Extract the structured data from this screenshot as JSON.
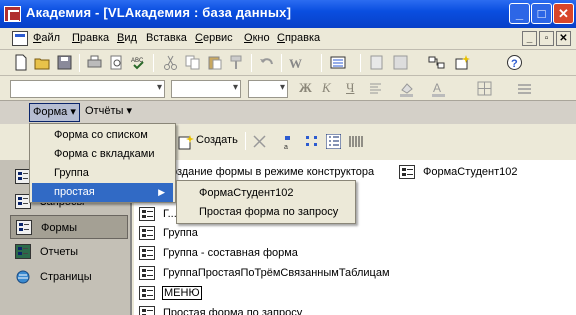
{
  "title": "Академия - [VLАкадемия : база данных]",
  "title_controls": [
    "_",
    "□",
    "✕"
  ],
  "menu": {
    "items": [
      {
        "u": "Ф",
        "rest": "айл"
      },
      {
        "u": "П",
        "rest": "равка"
      },
      {
        "u": "В",
        "rest": "ид"
      },
      {
        "u": "",
        "rest": "Вставка"
      },
      {
        "u": "С",
        "rest": "ервис"
      },
      {
        "u": "О",
        "rest": "кно"
      },
      {
        "u": "С",
        "rest": "правка"
      }
    ],
    "doc_controls": [
      "_",
      "▫",
      "✕"
    ]
  },
  "format_buttons": [
    "Ж",
    "К",
    "Ч"
  ],
  "object_bar": {
    "forma": "Форма ▾",
    "otchety": "Отчёты ▾"
  },
  "db_toolbar": {
    "create_label": "Создать"
  },
  "dropdown": {
    "items": [
      "Форма со списком",
      "Форма с вкладками",
      "Группа",
      "простая"
    ]
  },
  "submenu": {
    "items": [
      "ФормаСтудент102",
      "Простая форма по запросу"
    ]
  },
  "objects": {
    "items": [
      "",
      "Запросы",
      "Формы",
      "Отчеты",
      "Страницы"
    ]
  },
  "list": {
    "items": [
      "Создание формы в режиме конструктора",
      "Г...",
      "Группа",
      "Группа - составная форма",
      "ГруппаПростаяПоТрёмСвязаннымТаблицам",
      "МЕНЮ",
      "Простая форма по запросу"
    ],
    "col2_item": "ФормаСтудент102"
  },
  "colors": {
    "title_blue": "#0a4ee0",
    "highlight": "#316ac5",
    "close_red": "#d8462a"
  }
}
